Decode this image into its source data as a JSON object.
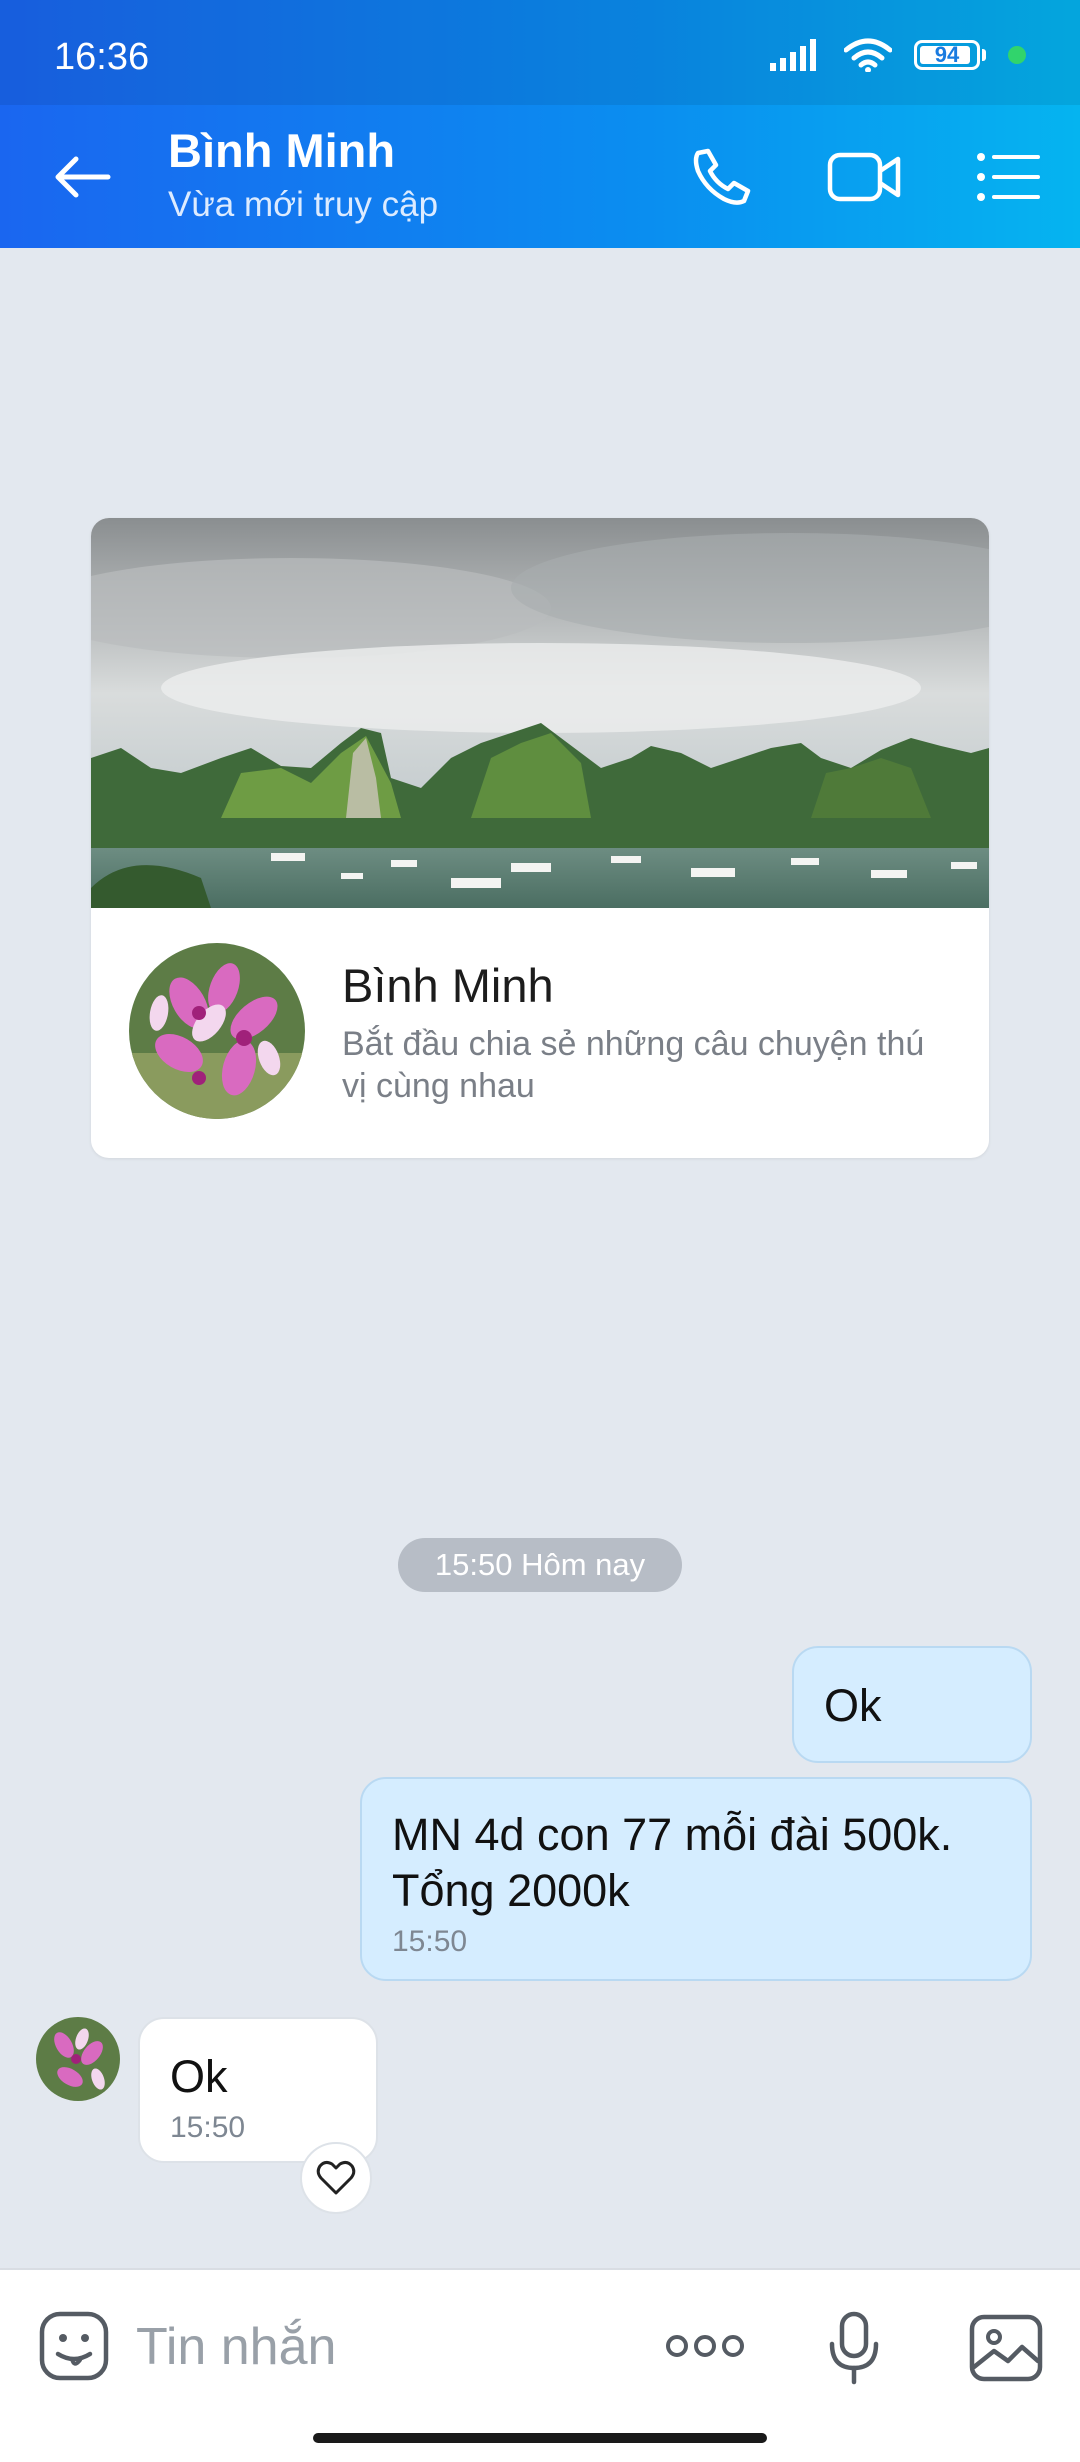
{
  "status_bar": {
    "time": "16:36",
    "battery": "94",
    "battery_level": 0.94
  },
  "header": {
    "title": "Bình Minh",
    "subtitle": "Vừa mới truy cập",
    "icons": [
      "back-arrow-icon",
      "phone-icon",
      "video-call-icon",
      "menu-list-icon"
    ]
  },
  "profile_card": {
    "name": "Bình Minh",
    "description": "Bắt đầu chia sẻ những câu chuyện thú vị cùng nhau"
  },
  "conversation": {
    "date_separator": "15:50 Hôm nay",
    "messages": [
      {
        "direction": "out",
        "text": "Ok",
        "time": ""
      },
      {
        "direction": "out",
        "text": "MN 4d con 77 mỗi đài 500k.\nTổng 2000k",
        "time": "15:50"
      },
      {
        "direction": "in",
        "text": "Ok",
        "time": "15:50"
      }
    ]
  },
  "input_bar": {
    "placeholder": "Tin nhắn"
  },
  "colors": {
    "header_start": "#1a66f0",
    "header_end": "#05b4f0",
    "out_bubble": "#d5edff",
    "background": "#e3e8ef"
  }
}
